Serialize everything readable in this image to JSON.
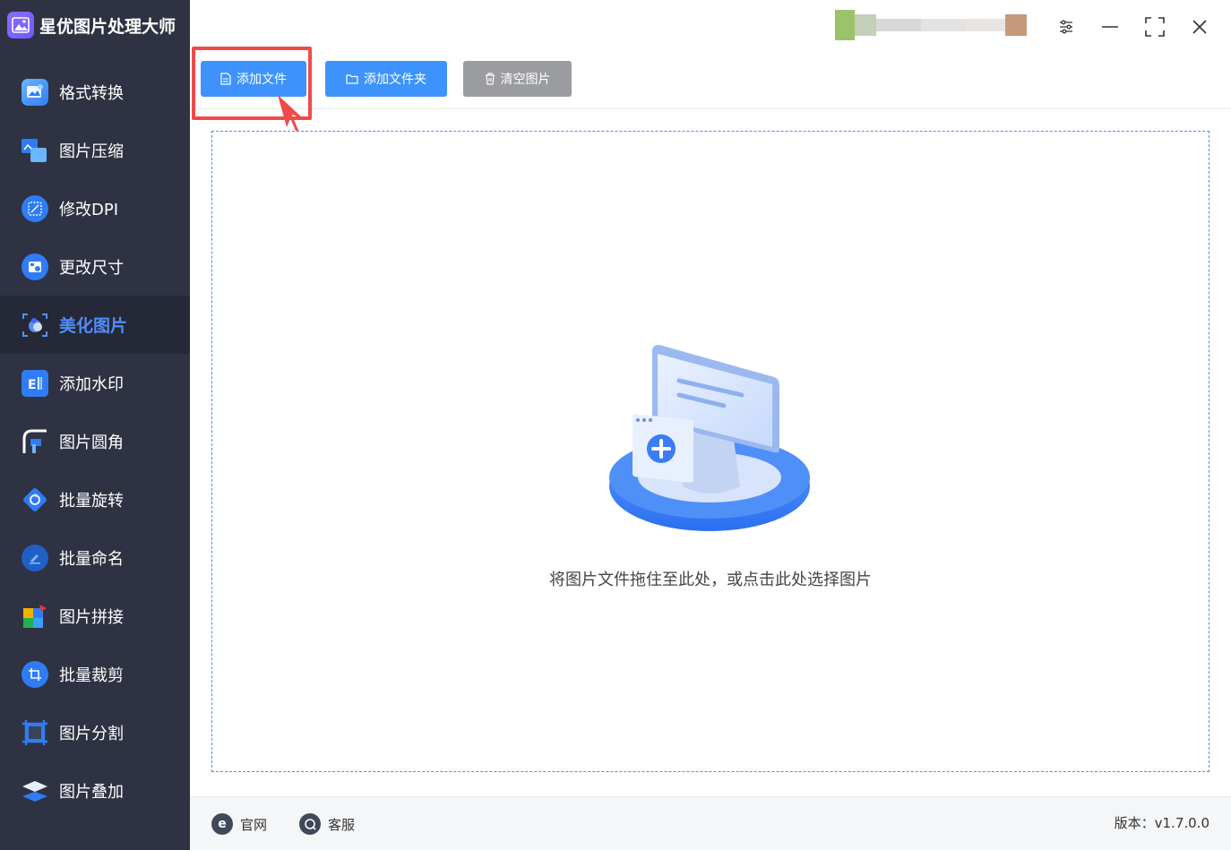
{
  "app": {
    "title": "星优图片处理大师"
  },
  "sidebar": {
    "items": [
      {
        "label": "格式转换",
        "icon": "format-convert-icon",
        "active": false
      },
      {
        "label": "图片压缩",
        "icon": "image-compress-icon",
        "active": false
      },
      {
        "label": "修改DPI",
        "icon": "dpi-icon",
        "active": false
      },
      {
        "label": "更改尺寸",
        "icon": "resize-icon",
        "active": false
      },
      {
        "label": "美化图片",
        "icon": "beautify-icon",
        "active": true
      },
      {
        "label": "添加水印",
        "icon": "watermark-icon",
        "active": false
      },
      {
        "label": "图片圆角",
        "icon": "rounded-corner-icon",
        "active": false
      },
      {
        "label": "批量旋转",
        "icon": "rotate-icon",
        "active": false
      },
      {
        "label": "批量命名",
        "icon": "rename-icon",
        "active": false
      },
      {
        "label": "图片拼接",
        "icon": "puzzle-icon",
        "active": false
      },
      {
        "label": "批量裁剪",
        "icon": "crop-icon",
        "active": false
      },
      {
        "label": "图片分割",
        "icon": "split-icon",
        "active": false
      },
      {
        "label": "图片叠加",
        "icon": "layers-icon",
        "active": false
      }
    ]
  },
  "toolbar": {
    "add_file": "添加文件",
    "add_folder": "添加文件夹",
    "clear_images": "清空图片"
  },
  "dropzone": {
    "hint": "将图片文件拖住至此处，或点击此处选择图片"
  },
  "footer": {
    "website": "官网",
    "support": "客服",
    "version": "版本：v1.7.0.0"
  },
  "colors": {
    "sidebar_bg": "#2e3242",
    "accent_blue": "#3d93fb",
    "clear_button_gray": "#9b9ca0",
    "highlight_red": "#f04a4a"
  }
}
